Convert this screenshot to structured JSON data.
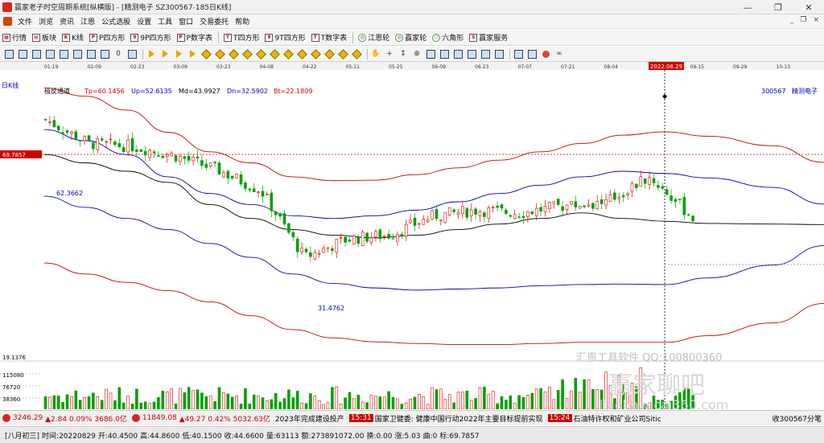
{
  "window": {
    "title": "赢家老子时空周期系统[纵横版] - [精测电子  SZ300567-185日K线]",
    "min_label": "—",
    "restore_label": "❐",
    "close_label": "✕"
  },
  "menu": {
    "items": [
      "文件",
      "浏览",
      "资讯",
      "江恩",
      "公式选股",
      "设置",
      "工具",
      "窗口",
      "交易委托",
      "帮助"
    ],
    "right_controls": [
      "_",
      "❐",
      "×"
    ]
  },
  "toolbar1": {
    "items": [
      {
        "label": "行情",
        "icon": "grid-icon"
      },
      {
        "label": "板块",
        "icon": "blocks-icon"
      },
      {
        "label": "K线",
        "icon": "kline-icon"
      },
      {
        "label": "P四方形",
        "icon": "square-p-icon"
      },
      {
        "label": "9P四方形",
        "icon": "square-9p-icon"
      },
      {
        "label": "P数字表",
        "icon": "table-p-icon"
      },
      {
        "label": "T四方形",
        "icon": "square-t-icon"
      },
      {
        "label": "9T四方形",
        "icon": "square-9t-icon"
      },
      {
        "label": "T数字表",
        "icon": "table-t-icon"
      },
      {
        "label": "江恩轮",
        "icon": "wheel-icon"
      },
      {
        "label": "赢家轮",
        "icon": "winner-wheel-icon"
      },
      {
        "label": "六角形",
        "icon": "hexagon-icon"
      },
      {
        "label": "赢家服务",
        "icon": "service-icon"
      }
    ]
  },
  "chart": {
    "period_label": "日K线",
    "indicator_name": "极反通道",
    "indicator_values": {
      "tp": "Tp=60.1456",
      "up": "Up=52.6135",
      "md": "Md=43.9927",
      "dn": "Dn=32.5902",
      "bt": "Bt=22.1809"
    },
    "stock_code": "300567",
    "stock_name": "精测电子",
    "price_marker": "69.7857",
    "high_label": "62.3662",
    "low_label": "31.4762",
    "volume_axis": [
      "19.1376",
      "115080",
      "76720",
      "38360"
    ],
    "cursor_date": "2022.08.29",
    "date_ticks": [
      "01-19",
      "02-09",
      "02-23",
      "03-09",
      "03-23",
      "04-08",
      "04-22",
      "05-11",
      "05-25",
      "06-09",
      "06-23",
      "07-07",
      "07-21",
      "08-04",
      "08-18",
      "09-15",
      "09-29",
      "10-13"
    ],
    "watermark1": "汇恩工具软件 QQ:100800360",
    "watermark2": "赢家聊吧",
    "watermark3": "liaoba.yicai360.com",
    "colors": {
      "up": "#e60000",
      "down": "#00a000",
      "md": "#000000",
      "upper_blue": "#0000cc",
      "outer_red": "#cc0000"
    }
  },
  "chart_data": {
    "type": "candlestick",
    "title": "",
    "ylabel": "",
    "xlabel": "",
    "ylim": [
      19.1376,
      69.7857
    ],
    "high": 62.3662,
    "low": 31.4762,
    "x": [
      "01-19",
      "02-09",
      "02-23",
      "03-09",
      "03-23",
      "04-08",
      "04-22",
      "05-11",
      "05-25",
      "06-09",
      "06-23",
      "07-07",
      "07-21",
      "08-04",
      "08-18",
      "08-29"
    ],
    "close": [
      62.3,
      58.0,
      57.5,
      55.8,
      53.2,
      49.5,
      37.5,
      40.8,
      41.6,
      45.0,
      46.0,
      45.5,
      46.8,
      47.4,
      52.0,
      44.66
    ],
    "series": [
      {
        "name": "Tp",
        "values": [
          68.0,
          66.5,
          64.0,
          60.0,
          56.5,
          54.5,
          52.0,
          51.3,
          51.4,
          52.4,
          53.6,
          55.0,
          56.5,
          58.0,
          59.5,
          60.1
        ]
      },
      {
        "name": "Up",
        "values": [
          60.5,
          58.5,
          56.0,
          52.0,
          49.0,
          47.0,
          45.0,
          44.5,
          45.0,
          46.0,
          47.5,
          49.0,
          50.5,
          52.0,
          53.0,
          52.6
        ]
      },
      {
        "name": "Md",
        "values": [
          56.0,
          54.5,
          53.0,
          51.0,
          47.0,
          44.5,
          42.5,
          41.5,
          41.0,
          41.5,
          42.5,
          43.5,
          44.5,
          45.5,
          44.5,
          44.0
        ]
      },
      {
        "name": "Dn",
        "values": [
          48.5,
          46.5,
          44.5,
          42.5,
          40.0,
          37.5,
          34.5,
          32.8,
          32.0,
          31.6,
          31.8,
          32.0,
          32.4,
          32.6,
          32.7,
          32.6
        ]
      },
      {
        "name": "Bt",
        "values": [
          36.5,
          34.5,
          33.0,
          31.5,
          29.5,
          27.0,
          24.5,
          23.0,
          22.3,
          22.0,
          21.8,
          21.8,
          22.0,
          22.2,
          22.2,
          22.2
        ]
      }
    ],
    "volume_ticks": [
      115080,
      76720,
      38360
    ]
  },
  "status1": {
    "sh_index": "3246.29",
    "sh_change": "▲2.84 0.09% 3686.0亿",
    "sz_index": "11849.08",
    "sz_change": "▲49.27 0.42% 5032.63亿",
    "news1": "2023年完成建设投产",
    "news_time1": "15:31",
    "news2": "国家卫健委: 健康中国行动2022年主要目标提前实现",
    "news_time2": "15:24",
    "news3": "石油特许权和矿业公司Sitic",
    "right_text": "收300567分笔"
  },
  "status2": {
    "lunar": "[八月初三]",
    "time": "时间:20220829",
    "open": "开:40.4500",
    "high": "高:44.8600",
    "low": "低:40.1500",
    "close": "收:44.6600",
    "volume": "量:63113",
    "amount": "额:273891072.00",
    "turnover": "换:0.00",
    "rise": "涨:5.03",
    "curve": "曲:0",
    "mark": "标:69.7857"
  }
}
